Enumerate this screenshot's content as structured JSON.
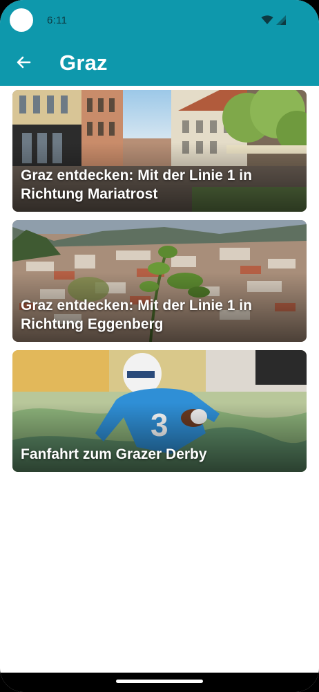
{
  "status_bar": {
    "time": "6:11",
    "icons": [
      "wifi-icon",
      "cell-signal-icon"
    ]
  },
  "app_bar": {
    "back_icon": "arrow-left-icon",
    "title": "Graz",
    "color": "#0e98ac"
  },
  "cards": [
    {
      "title": "Graz entdecken: Mit der Linie 1 in Richtung Mariatrost",
      "image": "street-scene-photo"
    },
    {
      "title": "Graz entdecken: Mit der Linie 1 in Richtung Eggenberg",
      "image": "city-panorama-photo"
    },
    {
      "title": "Fanfahrt zum Grazer Derby",
      "image": "football-player-photo"
    }
  ]
}
